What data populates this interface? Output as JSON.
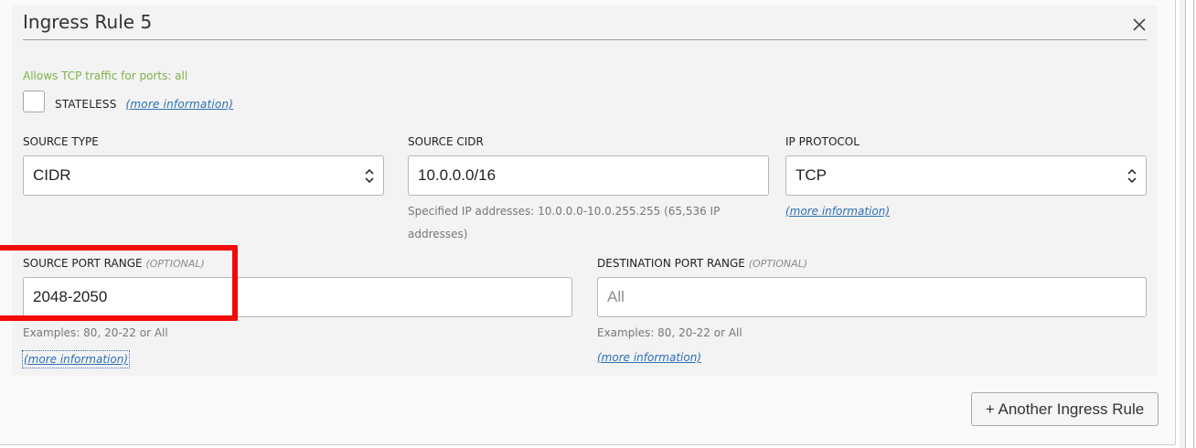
{
  "card": {
    "title": "Ingress Rule 5",
    "traffic_hint": "Allows TCP traffic for ports: all",
    "stateless_label": "STATELESS",
    "stateless_checked": false,
    "more_info": "(more information)"
  },
  "source_type": {
    "label": "SOURCE TYPE",
    "value": "CIDR"
  },
  "source_cidr": {
    "label": "SOURCE CIDR",
    "value": "10.0.0.0/16",
    "helper_line1": "Specified IP addresses: 10.0.0.0-10.0.255.255 (65,536 IP",
    "helper_line2": "addresses)"
  },
  "ip_protocol": {
    "label": "IP PROTOCOL",
    "value": "TCP",
    "more_info": "(more information)"
  },
  "source_port_range": {
    "label": "SOURCE PORT RANGE",
    "optional": "(OPTIONAL)",
    "value": "2048-2050",
    "helper": "Examples: 80, 20-22 or All",
    "more_info": "(more information)"
  },
  "destination_port_range": {
    "label": "DESTINATION PORT RANGE",
    "optional": "(OPTIONAL)",
    "value": "",
    "placeholder": "All",
    "helper": "Examples: 80, 20-22 or All",
    "more_info": "(more information)"
  },
  "actions": {
    "add_rule": "+ Another Ingress Rule"
  },
  "colors": {
    "hint_green": "#7db24a",
    "link_blue": "#2a6fb5",
    "highlight_red": "#f20a0a"
  }
}
